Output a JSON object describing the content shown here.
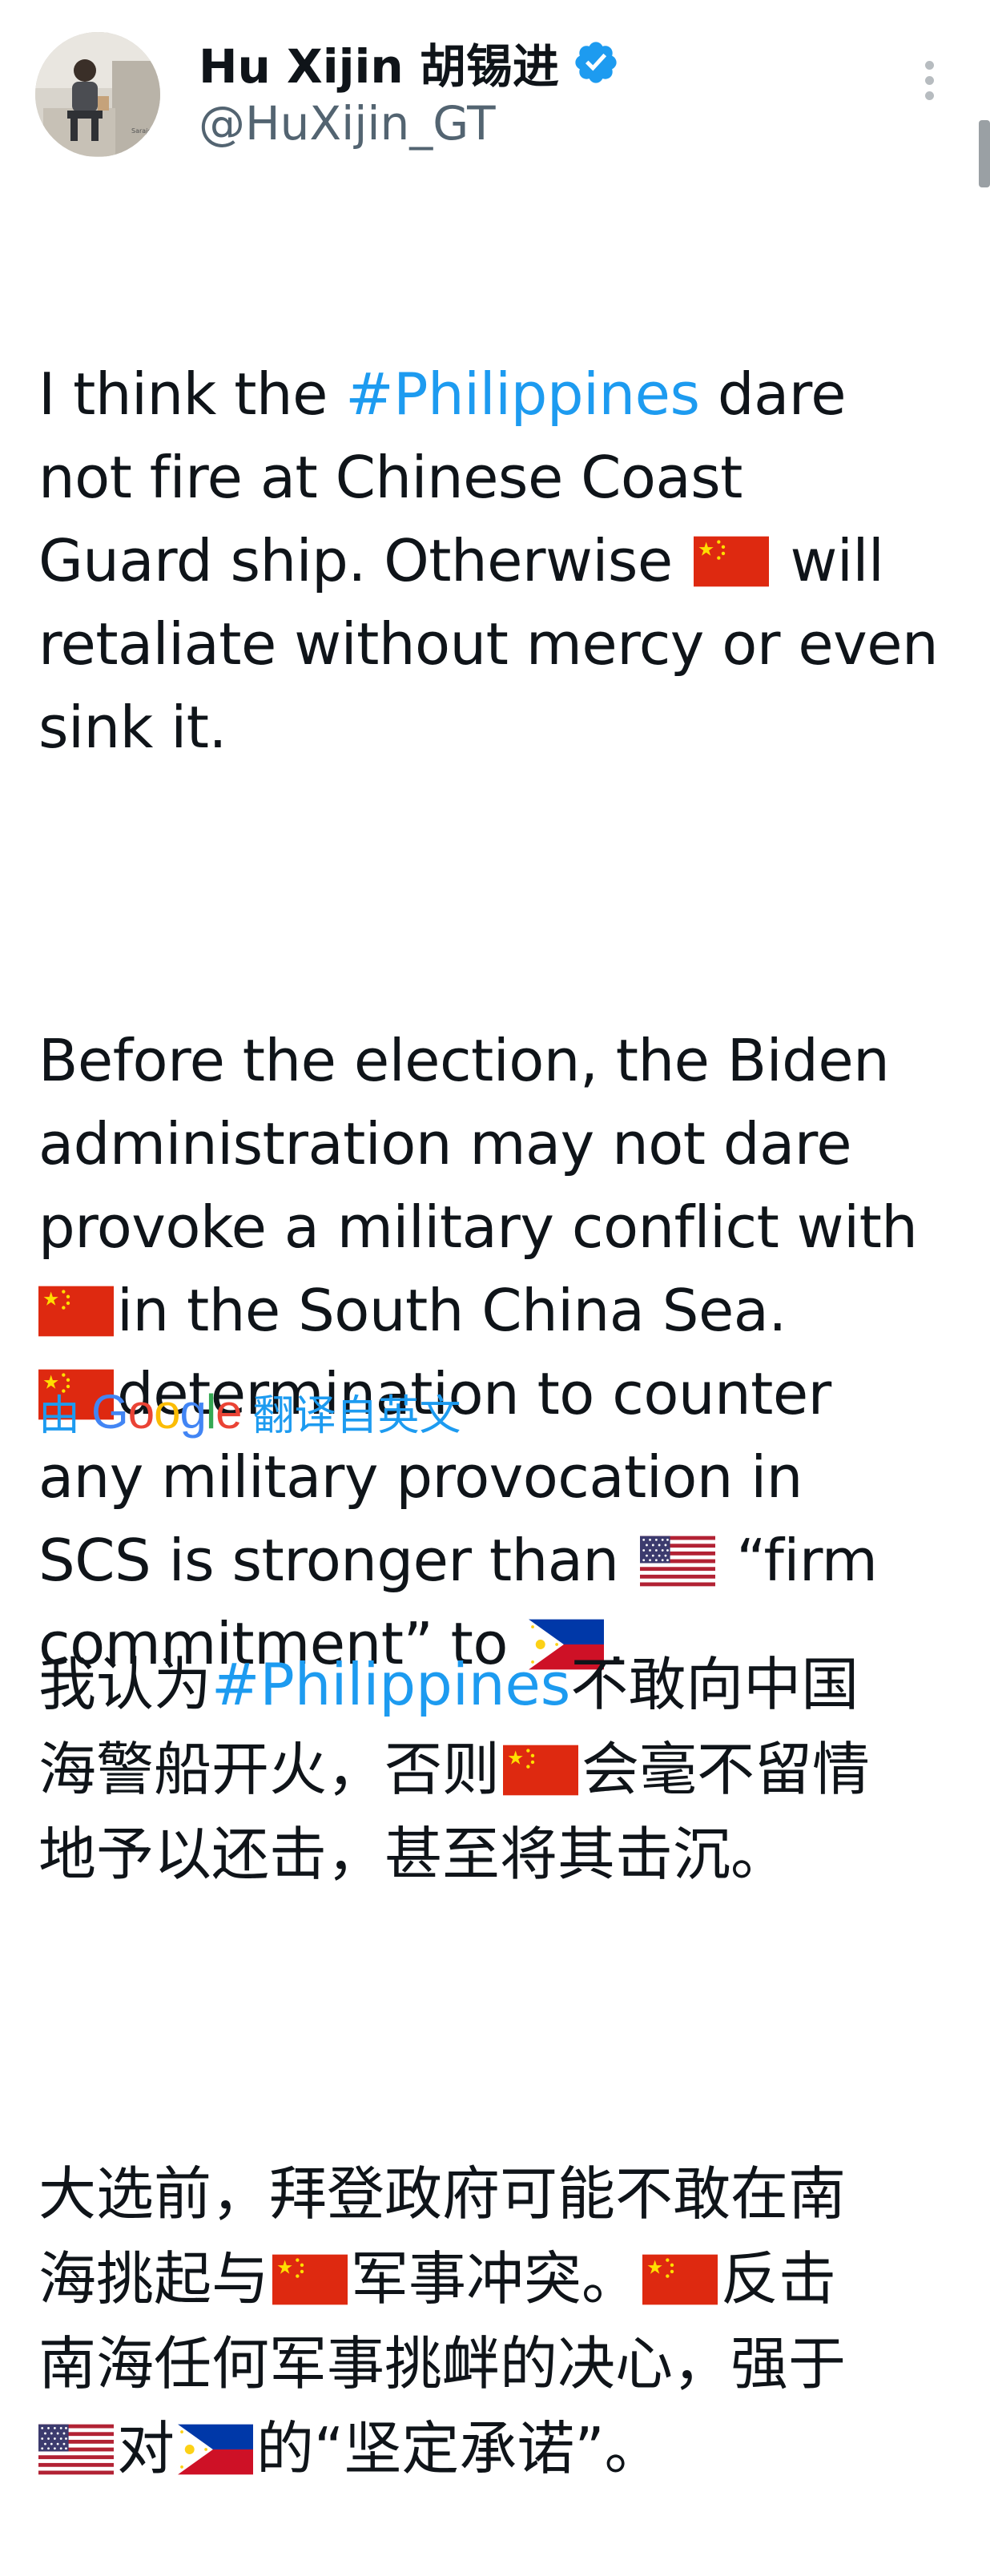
{
  "author": {
    "display_name": "Hu Xijin 胡锡进",
    "handle": "@HuXijin_GT",
    "verified_icon": "verified-badge-icon",
    "avatar_caption": "Sarajev"
  },
  "menu": {
    "more_icon": "more-vertical-icon"
  },
  "tweet": {
    "p1": {
      "part1": "I think the ",
      "hashtag": "#Philippines",
      "part2": " dare\nnot fire at Chinese Coast\nGuard ship. Otherwise ",
      "part3": " will\nretaliate without mercy or even\nsink it."
    },
    "p2": {
      "part1": "Before the election, the Biden\nadministration may not dare\nprovoke a military conflict with\n",
      "part2": "in the South China Sea.\n",
      "part3": "determination to counter\nany military provocation in\nSCS is stronger than ",
      "part4": " “firm\ncommitment” to ",
      "part5": "."
    }
  },
  "translation": {
    "prefix": "由",
    "google_label": "Google",
    "suffix": "翻译自英文",
    "p1": {
      "part1": "我认为",
      "hashtag": "#Philippines",
      "part2": "不敢向中国\n海警船开火，否则",
      "part3": "会毫不留情\n地予以还击，甚至将其击沉。"
    },
    "p2": {
      "part1": "大选前，拜登政府可能不敢在南\n海挑起与",
      "part2": "军事冲突。",
      "part3": "反击\n南海任何军事挑衅的决心，强于\n",
      "part4": "对",
      "part5": "的“坚定承诺”。"
    }
  },
  "colors": {
    "link": "#1d9bf0",
    "text": "#0f1419",
    "secondary": "#536471",
    "china_flag_red": "#de2910",
    "china_flag_yellow": "#ffde00",
    "us_flag_red": "#b22234",
    "us_flag_blue": "#3c3b6e",
    "ph_flag_blue": "#0038a8",
    "ph_flag_red": "#ce1126"
  },
  "flags": {
    "china": "china-flag-icon",
    "usa": "us-flag-icon",
    "philippines": "philippines-flag-icon"
  }
}
